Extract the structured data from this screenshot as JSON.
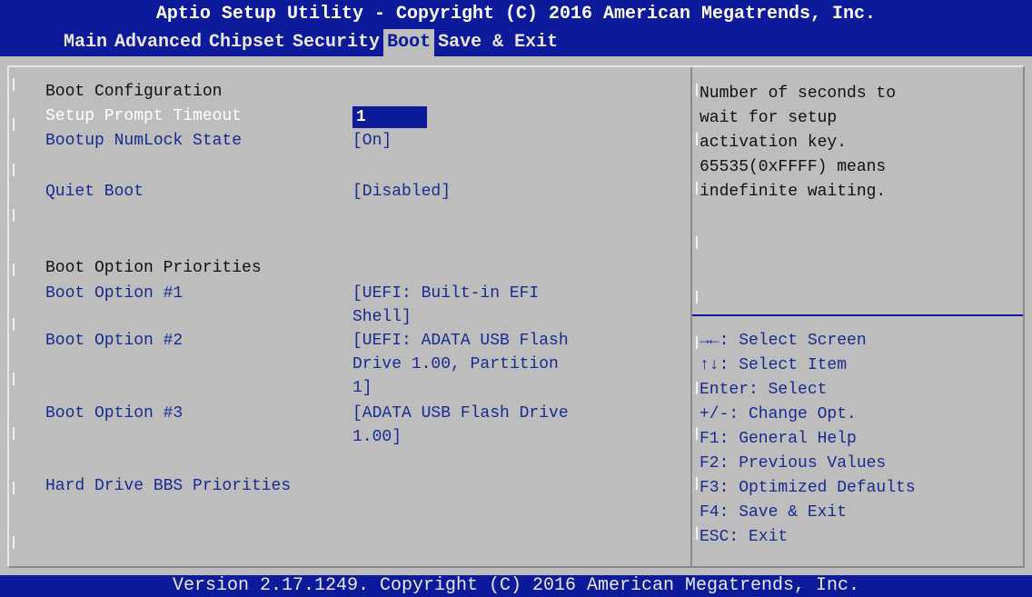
{
  "header": {
    "title": "Aptio Setup Utility - Copyright (C) 2016 American Megatrends, Inc."
  },
  "menu": {
    "items": [
      "Main",
      "Advanced",
      "Chipset",
      "Security",
      "Boot",
      "Save & Exit"
    ],
    "active": "Boot"
  },
  "main": {
    "section_boot_config": "Boot Configuration",
    "setup_prompt_timeout": {
      "label": "Setup Prompt Timeout",
      "value": "1"
    },
    "bootup_numlock": {
      "label": "Bootup NumLock State",
      "value": "[On]"
    },
    "quiet_boot": {
      "label": "Quiet Boot",
      "value": "[Disabled]"
    },
    "section_boot_priorities": "Boot Option Priorities",
    "boot_option_1": {
      "label": "Boot Option #1",
      "value_lines": [
        "[UEFI: Built-in EFI",
        "Shell]"
      ]
    },
    "boot_option_2": {
      "label": "Boot Option #2",
      "value_lines": [
        "[UEFI: ADATA USB Flash",
        "Drive 1.00, Partition",
        "1]"
      ]
    },
    "boot_option_3": {
      "label": "Boot Option #3",
      "value_lines": [
        "[ADATA USB Flash Drive",
        "1.00]"
      ]
    },
    "hard_drive_bbs": "Hard Drive BBS Priorities"
  },
  "help": {
    "lines": [
      "Number of seconds to",
      "wait for setup",
      "activation key.",
      "65535(0xFFFF) means",
      "indefinite waiting."
    ]
  },
  "keys": {
    "lines": [
      "→←: Select Screen",
      "↑↓: Select Item",
      "Enter: Select",
      "+/-: Change Opt.",
      "F1: General Help",
      "F2: Previous Values",
      "F3: Optimized Defaults",
      "F4: Save & Exit",
      "ESC: Exit"
    ]
  },
  "footer": {
    "text": "Version 2.17.1249. Copyright (C) 2016 American Megatrends, Inc."
  },
  "colors": {
    "bar_blue": "#0d1a99",
    "panel_gray": "#bdbdbd",
    "item_blue": "#1a2a8f",
    "highlight_white": "#ffffff"
  }
}
